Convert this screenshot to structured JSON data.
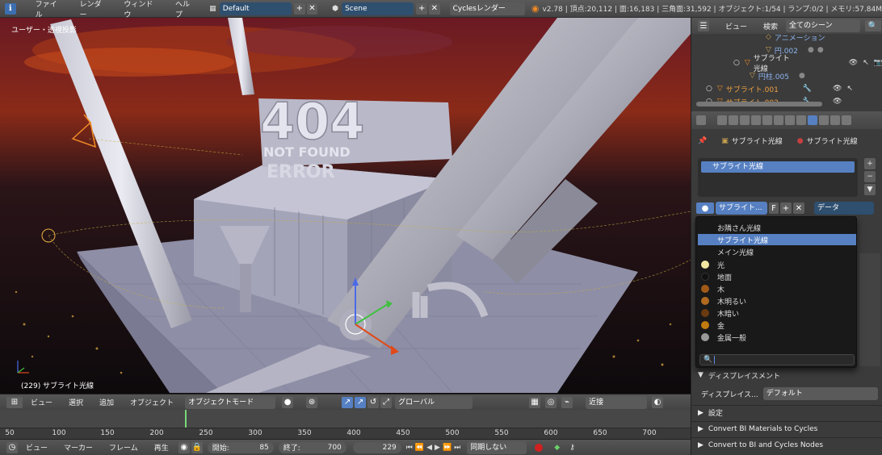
{
  "topbar": {
    "menus": [
      "ファイル",
      "レンダー",
      "ウィンドウ",
      "ヘルプ"
    ],
    "layout_name": "Default",
    "scene_name": "Scene",
    "engine": "Cyclesレンダー",
    "stats": "v2.78 | 頂点:20,112 | 面:16,183 | 三角面:31,592 | オブジェクト:1/54 | ランプ:0/2 | メモリ:57.84M"
  },
  "viewport": {
    "view_label": "ユーザー・透視投影",
    "status": "(229) サブライト光線",
    "sign_404": "404",
    "sign_line1": "NOT FOUND",
    "sign_line2": "ERROR"
  },
  "viewport_header": {
    "menus": [
      "ビュー",
      "選択",
      "追加",
      "オブジェクト"
    ],
    "mode": "オブジェクトモード",
    "orientation": "グローバル",
    "snap": "近接"
  },
  "timeline": {
    "ticks": [
      "50",
      "100",
      "150",
      "200",
      "250",
      "300",
      "350",
      "400",
      "450",
      "500",
      "550",
      "600",
      "650",
      "700"
    ],
    "current_frame": 229
  },
  "footer": {
    "menus": [
      "ビュー",
      "マーカー",
      "フレーム",
      "再生"
    ],
    "start_label": "開始:",
    "start_value": "85",
    "end_label": "終了:",
    "end_value": "700",
    "current": "229",
    "sync": "同期しない"
  },
  "outliner": {
    "header_view": "ビュー",
    "header_search": "検索",
    "scene_filter": "全てのシーン",
    "rows": [
      {
        "label": "アニメーション"
      },
      {
        "label": "円.002"
      },
      {
        "label": "サブライト光線"
      },
      {
        "label": "円柱.005"
      },
      {
        "label": "サブライト.001"
      },
      {
        "label": "サブライト.002"
      }
    ]
  },
  "properties": {
    "breadcrumb_object": "サブライト光線",
    "breadcrumb_material": "サブライト光線",
    "slot_name": "サブライト光線",
    "material_field": "サブライト...",
    "material_fake": "F",
    "link_type": "データ",
    "displacement_section": "ディスプレイスメント",
    "displacement_label": "ディスプレイス...",
    "displacement_value": "デフォルト",
    "settings_section": "設定",
    "convert1": "Convert BI Materials to Cycles",
    "convert2": "Convert to BI and Cycles Nodes"
  },
  "dropdown": {
    "items": [
      {
        "label": "お隣さん光線",
        "color": ""
      },
      {
        "label": "サブライト光線",
        "color": "",
        "selected": true
      },
      {
        "label": "メイン光線",
        "color": ""
      },
      {
        "label": "光",
        "color": "#f2e6a0"
      },
      {
        "label": "地面",
        "color": "#111111"
      },
      {
        "label": "木",
        "color": "#a05a18"
      },
      {
        "label": "木明るい",
        "color": "#b06a20"
      },
      {
        "label": "木暗い",
        "color": "#6a3a10"
      },
      {
        "label": "金",
        "color": "#c07a10"
      },
      {
        "label": "金属一般",
        "color": "#999999"
      }
    ]
  }
}
